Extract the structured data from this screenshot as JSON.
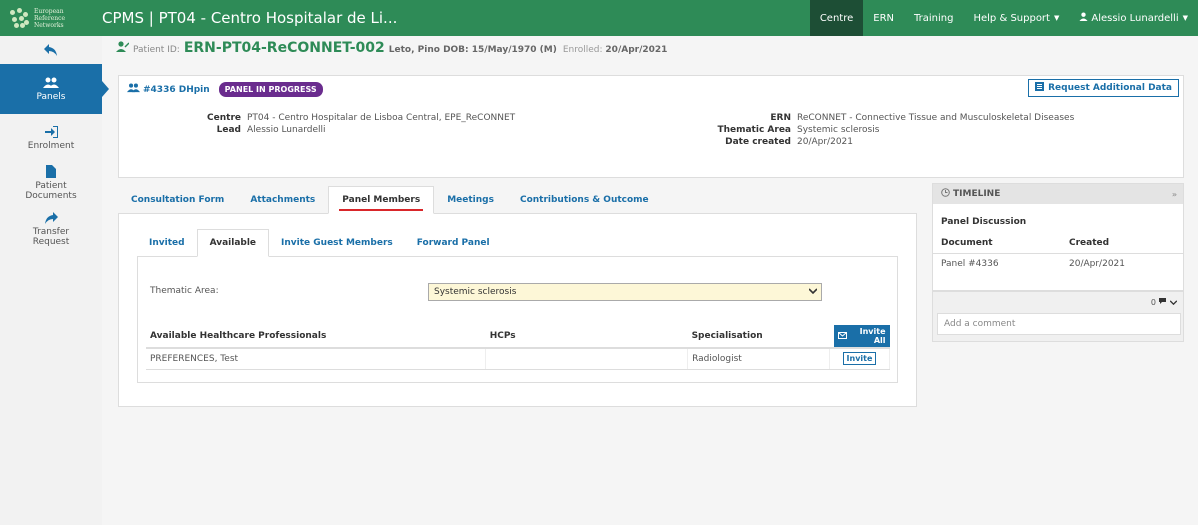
{
  "brand": {
    "lines": [
      "European",
      "Reference",
      "Networks"
    ]
  },
  "app_title": "CPMS | PT04 - Centro Hospitalar de Li...",
  "nav": {
    "centre": "Centre",
    "ern": "ERN",
    "training": "Training",
    "help": "Help & Support",
    "user": "Alessio Lunardelli"
  },
  "sidebar": {
    "items": [
      {
        "label": "Panels"
      },
      {
        "label": "Enrolment"
      },
      {
        "label_1": "Patient",
        "label_2": "Documents"
      },
      {
        "label_1": "Transfer",
        "label_2": "Request"
      }
    ]
  },
  "patient": {
    "id_label": "Patient ID:",
    "id": "ERN-PT04-ReCONNET-002",
    "name_dob": "Leto, Pino DOB: 15/May/1970 (M)",
    "enrolled_label": "Enrolled:",
    "enrolled_date": "20/Apr/2021"
  },
  "panel": {
    "id": "#4336 DHpin",
    "status": "PANEL IN PROGRESS",
    "request_button": "Request Additional Data",
    "centre_label": "Centre",
    "centre_value": "PT04 - Centro Hospitalar de Lisboa Central, EPE_ReCONNET",
    "lead_label": "Lead",
    "lead_value": "Alessio Lunardelli",
    "ern_label": "ERN",
    "ern_value": "ReCONNET - Connective Tissue and Musculoskeletal Diseases",
    "thematic_label": "Thematic Area",
    "thematic_value": "Systemic sclerosis",
    "date_label": "Date created",
    "date_value": "20/Apr/2021"
  },
  "tabs": [
    {
      "label": "Consultation Form"
    },
    {
      "label": "Attachments"
    },
    {
      "label": "Panel Members"
    },
    {
      "label": "Meetings"
    },
    {
      "label": "Contributions & Outcome"
    }
  ],
  "subtabs": [
    {
      "label": "Invited"
    },
    {
      "label": "Available"
    },
    {
      "label": "Invite Guest Members"
    },
    {
      "label": "Forward Panel"
    }
  ],
  "filter": {
    "label": "Thematic Area:",
    "selected": "Systemic sclerosis"
  },
  "hcp_table": {
    "headers": [
      "Available Healthcare Professionals",
      "HCPs",
      "Specialisation"
    ],
    "invite_all": "Invite All",
    "rows": [
      {
        "name": "PREFERENCES, Test",
        "hcps": "",
        "specialisation": "Radiologist",
        "action": "Invite"
      }
    ]
  },
  "timeline": {
    "title": "TIMELINE",
    "section": "Panel Discussion",
    "headers": [
      "Document",
      "Created"
    ],
    "rows": [
      {
        "document": "Panel #4336",
        "created": "20/Apr/2021"
      }
    ]
  },
  "comments": {
    "count": "0",
    "placeholder": "Add a comment"
  },
  "colors": {
    "navbar": "#2e8b57",
    "nav_active": "#1d4e35",
    "primary": "#1a6fa8",
    "badge": "#6a2c8e",
    "tab_underline": "#d9262a",
    "select_bg": "#fdf7d7"
  }
}
